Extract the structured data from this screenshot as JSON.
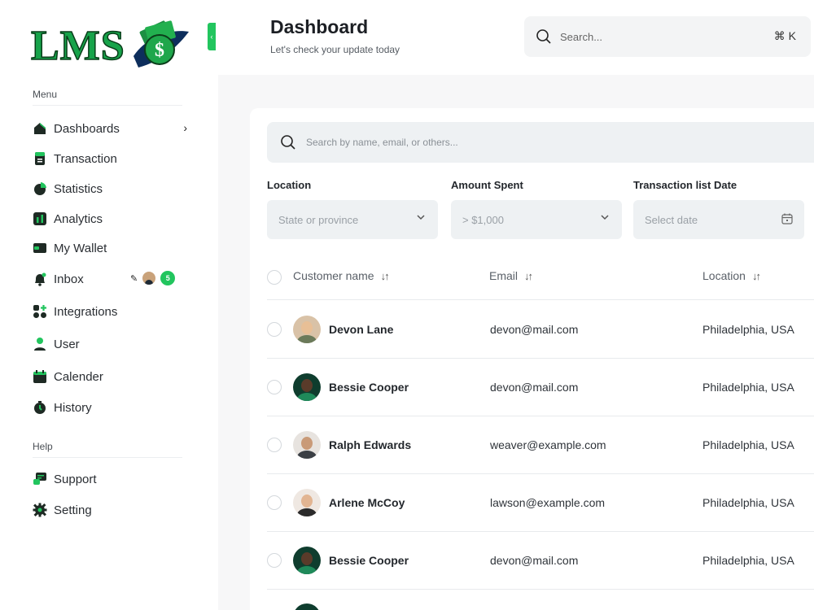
{
  "app": {
    "logo_text": "LMS",
    "brand_color": "#22c55e"
  },
  "header": {
    "title": "Dashboard",
    "subtitle": "Let's check your update today",
    "search_placeholder": "Search...",
    "shortcut": "⌘ K"
  },
  "sidebar": {
    "menu_label": "Menu",
    "help_label": "Help",
    "items": [
      {
        "label": "Dashboards",
        "icon": "home-icon"
      },
      {
        "label": "Transaction",
        "icon": "receipt-icon"
      },
      {
        "label": "Statistics",
        "icon": "pie-chart-icon"
      },
      {
        "label": "Analytics",
        "icon": "analytics-icon"
      },
      {
        "label": "My Wallet",
        "icon": "wallet-icon"
      },
      {
        "label": "Inbox",
        "icon": "bell-icon",
        "badge": "5"
      },
      {
        "label": "Integrations",
        "icon": "integrations-icon"
      },
      {
        "label": "User",
        "icon": "user-icon"
      },
      {
        "label": "Calender",
        "icon": "calendar-icon"
      },
      {
        "label": "History",
        "icon": "history-icon"
      }
    ],
    "help_items": [
      {
        "label": "Support",
        "icon": "support-icon"
      },
      {
        "label": "Setting",
        "icon": "gear-icon"
      }
    ]
  },
  "filters": {
    "search_placeholder": "Search by name, email, or others...",
    "location": {
      "label": "Location",
      "placeholder": "State or province"
    },
    "amount": {
      "label": "Amount Spent",
      "placeholder": "> $1,000"
    },
    "date": {
      "label": "Transaction list Date",
      "placeholder": "Select date"
    }
  },
  "table": {
    "columns": [
      "Customer name",
      "Email",
      "Location"
    ],
    "rows": [
      {
        "name": "Devon Lane",
        "email": "devon@mail.com",
        "location": "Philadelphia, USA",
        "avatar_bg": "#d9c2a7",
        "skin": "#e8bf96",
        "shirt": "#6b7a5a"
      },
      {
        "name": "Bessie Cooper",
        "email": "devon@mail.com",
        "location": "Philadelphia, USA",
        "avatar_bg": "#0f3d2e",
        "skin": "#5a3b2a",
        "shirt": "#1f8a5a"
      },
      {
        "name": "Ralph Edwards",
        "email": "weaver@example.com",
        "location": "Philadelphia, USA",
        "avatar_bg": "#e7e3df",
        "skin": "#c99a78",
        "shirt": "#3b3f45"
      },
      {
        "name": "Arlene McCoy",
        "email": "lawson@example.com",
        "location": "Philadelphia, USA",
        "avatar_bg": "#efe8e2",
        "skin": "#e2b592",
        "shirt": "#2b2b2b"
      },
      {
        "name": "Bessie Cooper",
        "email": "devon@mail.com",
        "location": "Philadelphia, USA",
        "avatar_bg": "#0f3d2e",
        "skin": "#5a3b2a",
        "shirt": "#1f8a5a"
      }
    ]
  }
}
